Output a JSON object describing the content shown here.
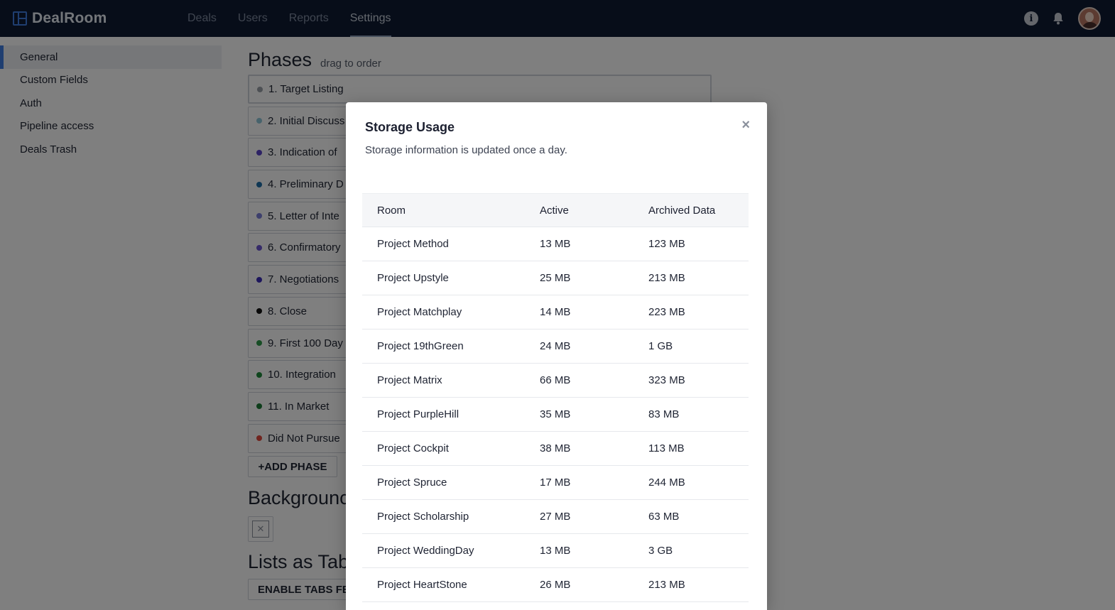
{
  "app": {
    "name": "DealRoom"
  },
  "nav": {
    "items": [
      {
        "label": "Deals"
      },
      {
        "label": "Users"
      },
      {
        "label": "Reports"
      },
      {
        "label": "Settings",
        "active": true
      }
    ]
  },
  "sidebar": {
    "items": [
      {
        "label": "General",
        "active": true
      },
      {
        "label": "Custom Fields"
      },
      {
        "label": "Auth"
      },
      {
        "label": "Pipeline access"
      },
      {
        "label": "Deals Trash"
      }
    ]
  },
  "main": {
    "phases_title": "Phases",
    "phases_hint": "drag to order",
    "phases": [
      {
        "label": "1. Target Listing",
        "color": "#9aa0a8"
      },
      {
        "label": "2. Initial Discuss",
        "color": "#8fc7d8"
      },
      {
        "label": "3. Indication of",
        "color": "#5a44c8"
      },
      {
        "label": "4. Preliminary D",
        "color": "#1f6fa8"
      },
      {
        "label": "5. Letter of Inte",
        "color": "#7a7fd8"
      },
      {
        "label": "6. Confirmatory",
        "color": "#6a54d0"
      },
      {
        "label": "7. Negotiations",
        "color": "#3a2cb8"
      },
      {
        "label": "8. Close",
        "color": "#111111"
      },
      {
        "label": "9. First 100 Day",
        "color": "#2e9a4a"
      },
      {
        "label": "10. Integration",
        "color": "#1e8a3a"
      },
      {
        "label": "11. In Market",
        "color": "#1a7a34"
      },
      {
        "label": "Did Not Pursue",
        "color": "#e0483c"
      }
    ],
    "add_phase_label": "+ADD PHASE",
    "background_title": "Backgrounc",
    "lists_title": "Lists as Tab",
    "enable_tabs_label": "ENABLE TABS FE"
  },
  "modal": {
    "title": "Storage Usage",
    "subtitle": "Storage information is updated once a day.",
    "close_label": "×",
    "columns": [
      "Room",
      "Active",
      "Archived Data"
    ],
    "rows": [
      [
        "Project Method",
        "13 MB",
        "123 MB"
      ],
      [
        "Project Upstyle",
        "25 MB",
        "213 MB"
      ],
      [
        "Project Matchplay",
        "14 MB",
        "223 MB"
      ],
      [
        "Project 19thGreen",
        "24 MB",
        "1 GB"
      ],
      [
        "Project Matrix",
        "66 MB",
        "323 MB"
      ],
      [
        "Project PurpleHill",
        "35 MB",
        "83 MB"
      ],
      [
        "Project Cockpit",
        "38 MB",
        "113 MB"
      ],
      [
        "Project Spruce",
        "17 MB",
        "244 MB"
      ],
      [
        "Project Scholarship",
        "27 MB",
        "63 MB"
      ],
      [
        "Project WeddingDay",
        "13 MB",
        "3 GB"
      ],
      [
        "Project HeartStone",
        "26 MB",
        "213 MB"
      ]
    ]
  },
  "colors": {
    "topbar": "#0f1b33",
    "accent": "#3f7de0",
    "overlay": "rgba(0,0,0,0.5)"
  },
  "icons": {
    "info": "info-icon",
    "notifications": "bell-icon",
    "avatar": "user-avatar"
  }
}
